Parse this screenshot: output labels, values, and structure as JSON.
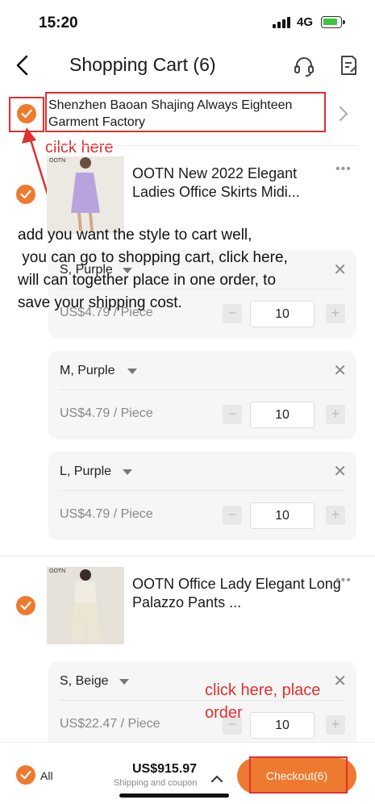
{
  "status_bar": {
    "time": "15:20",
    "network": "4G"
  },
  "nav": {
    "title": "Shopping Cart (6)"
  },
  "store": {
    "name": "Shenzhen Baoan Shajing Always Eighteen Garment Factory"
  },
  "annotations": {
    "store_hint": "cilck here",
    "overlay_lines": [
      "add you want the style to cart well,",
      " you can go to shopping cart, click here,",
      "will can together place in one order, to",
      "save your shipping cost."
    ],
    "checkout_hint_line1": "click here, place",
    "checkout_hint_line2": "order"
  },
  "products": [
    {
      "brand_tag": "OOTN",
      "title": "OOTN New 2022 Elegant Ladies Office Skirts Midi...",
      "skus": [
        {
          "variant": "S, Purple",
          "price": "US$4.79 / Piece",
          "qty": "10"
        },
        {
          "variant": "M, Purple",
          "price": "US$4.79 / Piece",
          "qty": "10"
        },
        {
          "variant": "L, Purple",
          "price": "US$4.79 / Piece",
          "qty": "10"
        }
      ]
    },
    {
      "brand_tag": "OOTN",
      "title": "OOTN Office Lady Elegant Long Palazzo Pants ...",
      "skus": [
        {
          "variant": "S, Beige",
          "price": "US$22.47 / Piece",
          "qty": "10"
        }
      ]
    }
  ],
  "bottom_bar": {
    "select_all_label": "All",
    "total": "US$915.97",
    "shipping_note": "Shipping and coupon",
    "checkout_label": "Checkout(6)"
  },
  "icons": {
    "back": "chevron-left-icon",
    "customer_service": "headset-icon",
    "note": "edit-note-icon",
    "check": "check-circle-icon",
    "more": "ellipsis-icon",
    "close": "close-icon"
  },
  "colors": {
    "accent": "#ee7a30",
    "annotation_red": "#e0302f",
    "card_bg": "#f6f6f6"
  }
}
